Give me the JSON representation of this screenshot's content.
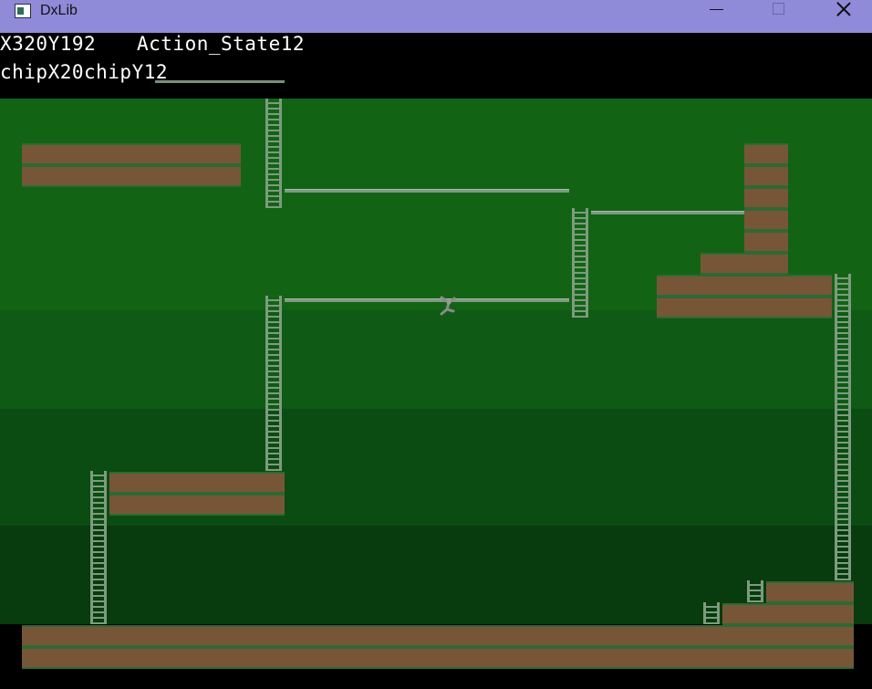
{
  "window": {
    "title": "DxLib",
    "icon": "app-window-icon",
    "buttons": [
      "minimize-icon",
      "maximize-icon",
      "close-icon"
    ]
  },
  "hud": {
    "position": "X320Y192",
    "action_state": "Action_State12",
    "chip": "chipX20chipY12"
  },
  "colors": {
    "title_bar": "#8f8bd9",
    "hud_background": "#000000",
    "hud_text": "#ffffff",
    "background_bands": [
      "#136315",
      "#0f5a15",
      "#0b4c12",
      "#083b0e"
    ],
    "brick": "#775637",
    "brick_edge": "#2c6a33",
    "ladder": "#7d9b7f",
    "rope": "#7f9884"
  },
  "scene": {
    "tiles": [
      "brick-block",
      "ladder",
      "rope",
      "player-sprite"
    ]
  }
}
